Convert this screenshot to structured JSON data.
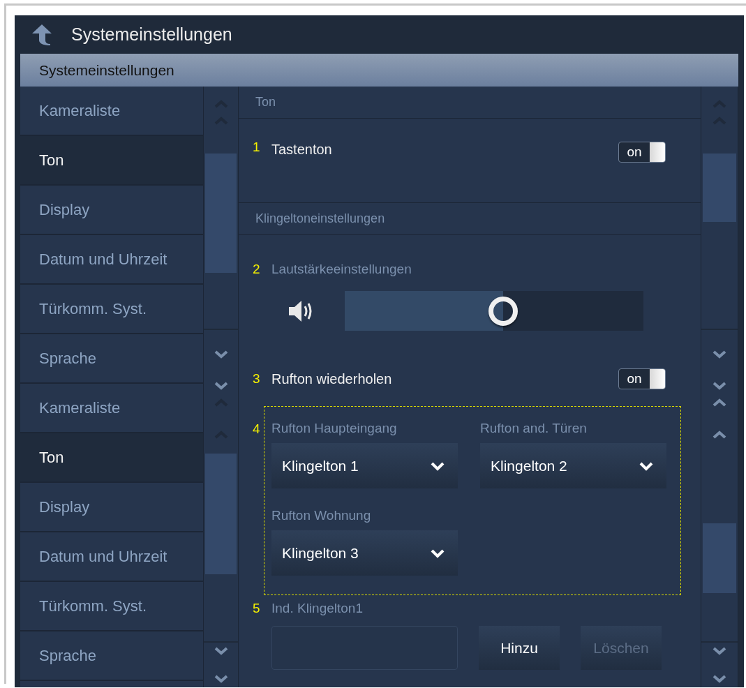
{
  "header": {
    "title": "Systemeinstellungen"
  },
  "subheader": {
    "title": "Systemeinstellungen"
  },
  "sidebar": {
    "items": [
      {
        "label": "Kameraliste",
        "selected": false
      },
      {
        "label": "Ton",
        "selected": true
      },
      {
        "label": "Display",
        "selected": false
      },
      {
        "label": "Datum und Uhrzeit",
        "selected": false
      },
      {
        "label": "Türkomm. Syst.",
        "selected": false
      },
      {
        "label": "Sprache",
        "selected": false
      },
      {
        "label": "Kameraliste",
        "selected": false
      },
      {
        "label": "Ton",
        "selected": true
      },
      {
        "label": "Display",
        "selected": false
      },
      {
        "label": "Datum und Uhrzeit",
        "selected": false
      },
      {
        "label": "Türkomm. Syst.",
        "selected": false
      },
      {
        "label": "Sprache",
        "selected": false
      }
    ]
  },
  "content": [
    {
      "kind": "section",
      "title": "Ton"
    },
    {
      "kind": "toggle",
      "number": "1",
      "label": "Tastenton",
      "on": true,
      "state_text": "on"
    },
    {
      "kind": "section",
      "title": "Klingeltoneinstellungen"
    },
    {
      "kind": "slider",
      "number": "2",
      "label": "Lautstärkeeinstellungen",
      "level": 0.53
    },
    {
      "kind": "toggle",
      "number": "3",
      "label": "Rufton wiederholen",
      "on": true,
      "state_text": "on"
    },
    {
      "kind": "dropdowns",
      "number": "4",
      "highlighted": true,
      "fields": [
        {
          "label": "Rufton Haupteingang",
          "value": "Klingelton 1"
        },
        {
          "label": "Rufton and. Türen",
          "value": "Klingelton 2"
        },
        {
          "label": "Rufton Wohnung",
          "value": "Klingelton 3"
        }
      ]
    },
    {
      "kind": "file",
      "number": "5",
      "label": "Ind. Klingelton1",
      "buttons": [
        {
          "label": "Hinzu",
          "disabled": false
        },
        {
          "label": "Löschen",
          "disabled": true
        }
      ]
    }
  ]
}
